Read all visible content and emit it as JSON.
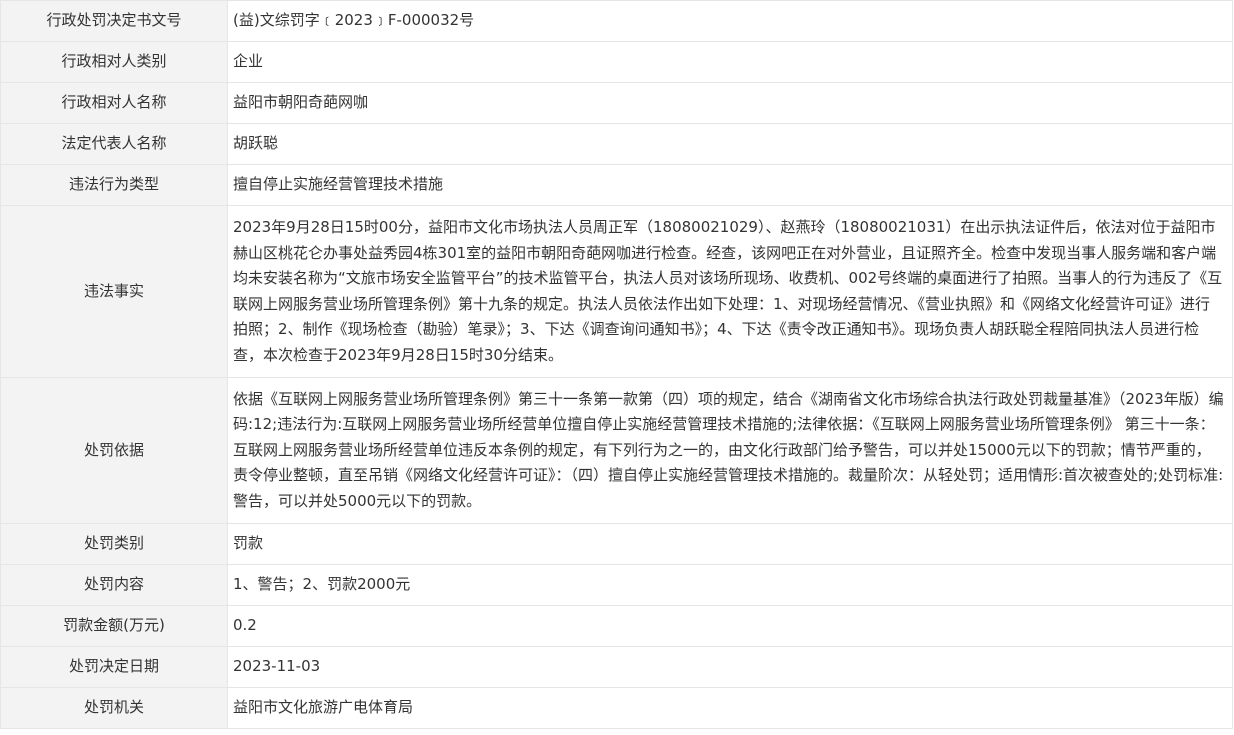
{
  "rows": [
    {
      "id": "decision-number",
      "label": "行政处罚决定书文号",
      "value": "(益)文综罚字﹝2023﹞F-000032号"
    },
    {
      "id": "party-category",
      "label": "行政相对人类别",
      "value": "企业"
    },
    {
      "id": "party-name",
      "label": "行政相对人名称",
      "value": "益阳市朝阳奇葩网咖"
    },
    {
      "id": "legal-representative",
      "label": "法定代表人名称",
      "value": "胡跃聪"
    },
    {
      "id": "violation-type",
      "label": "违法行为类型",
      "value": "擅自停止实施经营管理技术措施"
    },
    {
      "id": "violation-facts",
      "label": "违法事实",
      "value": "2023年9月28日15时00分，益阳市文化市场执法人员周正军（18080021029）、赵燕玲（18080021031）在出示执法证件后，依法对位于益阳市赫山区桃花仑办事处益秀园4栋301室的益阳市朝阳奇葩网咖进行检查。经查，该网吧正在对外营业，且证照齐全。检查中发现当事人服务端和客户端均未安装名称为“文旅市场安全监管平台”的技术监管平台，执法人员对该场所现场、收费机、002号终端的桌面进行了拍照。当事人的行为违反了《互联网上网服务营业场所管理条例》第十九条的规定。执法人员依法作出如下处理：1、对现场经营情况、《营业执照》和《网络文化经营许可证》进行拍照；2、制作《现场检查（勘验）笔录》；3、下达《调查询问通知书》；4、下达《责令改正通知书》。现场负责人胡跃聪全程陪同执法人员进行检查，本次检查于2023年9月28日15时30分结束。"
    },
    {
      "id": "penalty-basis",
      "label": "处罚依据",
      "value": "依据《互联网上网服务营业场所管理条例》第三十一条第一款第（四）项的规定，结合《湖南省文化市场综合执法行政处罚裁量基准》（2023年版）编码:12;违法行为:互联网上网服务营业场所经营单位擅自停止实施经营管理技术措施的;法律依据：《互联网上网服务营业场所管理条例》 第三十一条：互联网上网服务营业场所经营单位违反本条例的规定，有下列行为之一的，由文化行政部门给予警告，可以并处15000元以下的罚款；情节严重的，责令停业整顿，直至吊销《网络文化经营许可证》：（四）擅自停止实施经营管理技术措施的。裁量阶次：从轻处罚；适用情形:首次被查处的;处罚标准:警告，可以并处5000元以下的罚款。"
    },
    {
      "id": "penalty-category",
      "label": "处罚类别",
      "value": "罚款"
    },
    {
      "id": "penalty-content",
      "label": "处罚内容",
      "value": "1、警告；2、罚款2000元"
    },
    {
      "id": "fine-amount",
      "label": "罚款金额(万元)",
      "value": "0.2"
    },
    {
      "id": "decision-date",
      "label": "处罚决定日期",
      "value": "2023-11-03"
    },
    {
      "id": "penalty-authority",
      "label": "处罚机关",
      "value": "益阳市文化旅游广电体育局"
    }
  ]
}
